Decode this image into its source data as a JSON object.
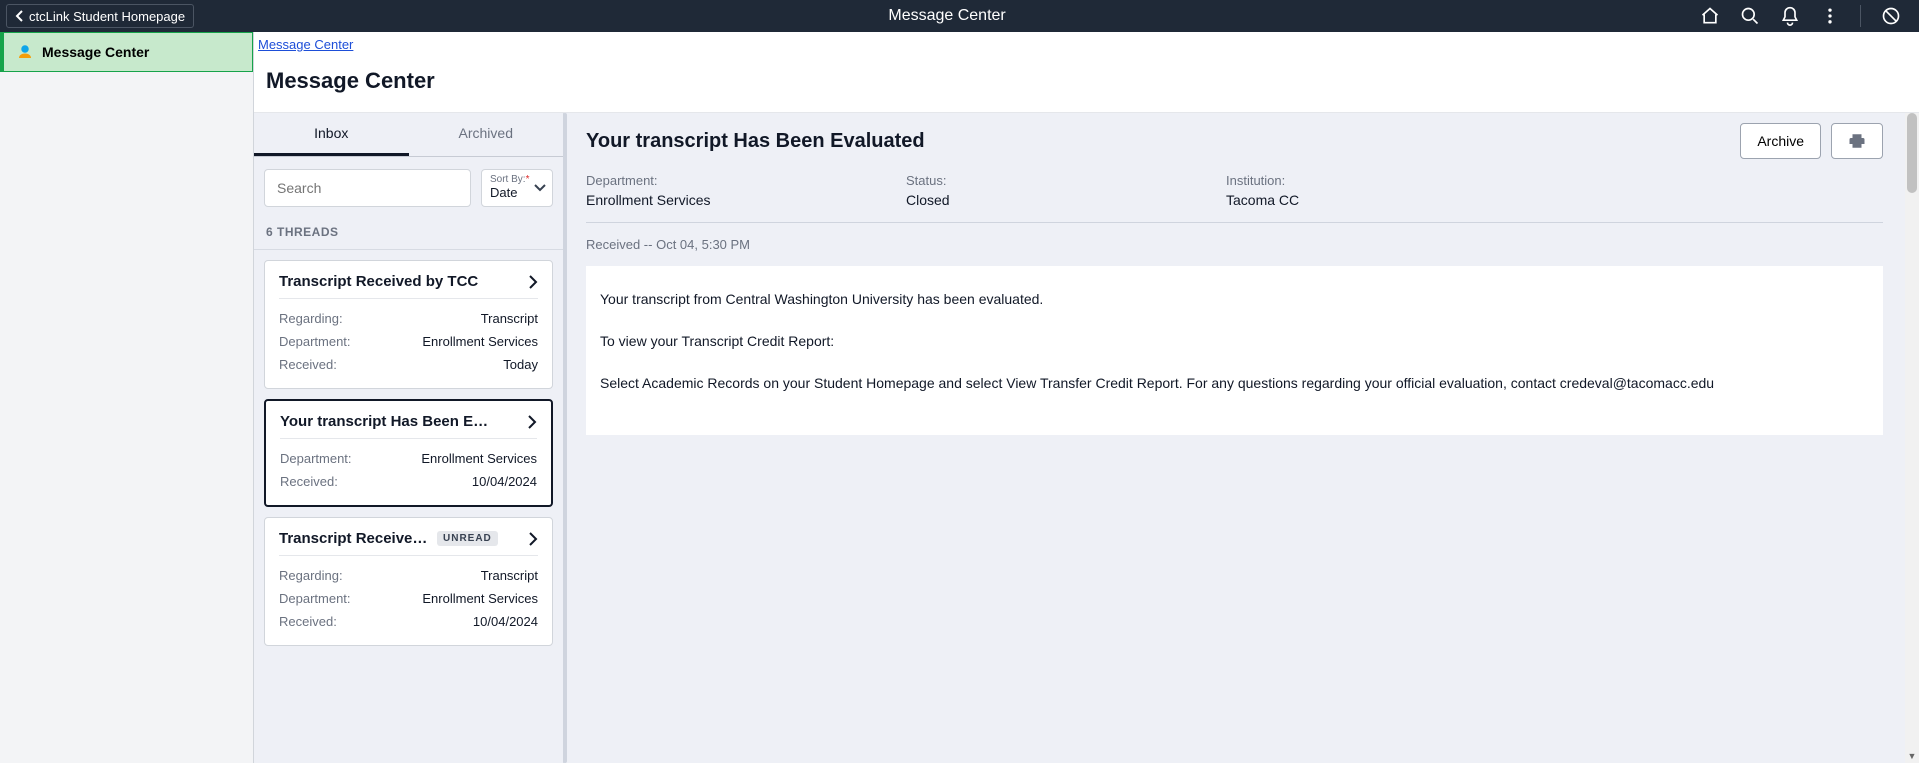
{
  "topbar": {
    "back_label": "ctcLink Student Homepage",
    "title": "Message Center"
  },
  "leftnav": {
    "item_label": "Message Center"
  },
  "breadcrumb": {
    "link": "Message Center"
  },
  "page": {
    "title": "Message Center"
  },
  "tabs": {
    "inbox": "Inbox",
    "archived": "Archived"
  },
  "search": {
    "placeholder": "Search"
  },
  "sort": {
    "label": "Sort By:",
    "value": "Date"
  },
  "threads_label": "6 THREADS",
  "threads": [
    {
      "title": "Transcript Received by TCC",
      "regarding_k": "Regarding:",
      "regarding_v": "Transcript",
      "department_k": "Department:",
      "department_v": "Enrollment Services",
      "received_k": "Received:",
      "received_v": "Today"
    },
    {
      "title": "Your transcript Has Been Evalua...",
      "department_k": "Department:",
      "department_v": "Enrollment Services",
      "received_k": "Received:",
      "received_v": "10/04/2024"
    },
    {
      "title": "Transcript Received by ...",
      "unread": "UNREAD",
      "regarding_k": "Regarding:",
      "regarding_v": "Transcript",
      "department_k": "Department:",
      "department_v": "Enrollment Services",
      "received_k": "Received:",
      "received_v": "10/04/2024"
    }
  ],
  "detail": {
    "title": "Your transcript Has Been Evaluated",
    "archive_btn": "Archive",
    "meta": {
      "department_k": "Department:",
      "department_v": "Enrollment Services",
      "status_k": "Status:",
      "status_v": "Closed",
      "institution_k": "Institution:",
      "institution_v": "Tacoma CC"
    },
    "received": "Received -- Oct 04, 5:30 PM",
    "body": {
      "p1": "Your transcript from Central Washington University has been evaluated.",
      "p2": "To view your Transcript Credit Report:",
      "p3": "Select Academic Records on your Student Homepage and select View Transfer Credit Report. For any questions regarding your official evaluation, contact credeval@tacomacc.edu"
    }
  }
}
